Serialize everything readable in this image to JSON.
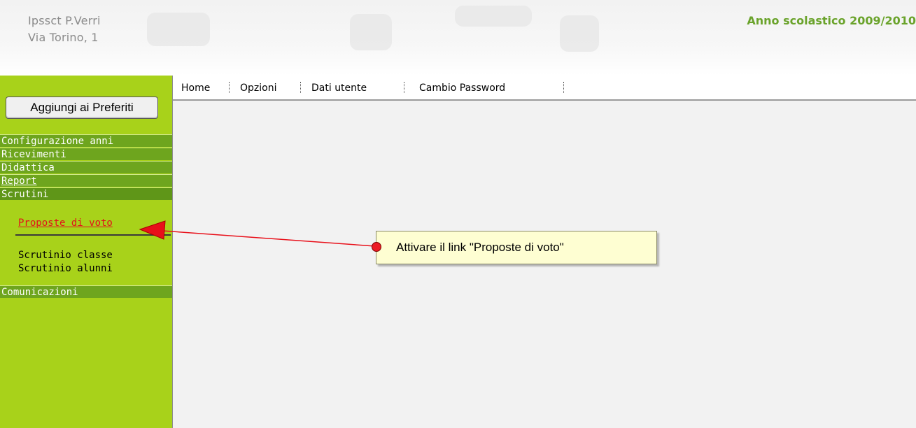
{
  "header": {
    "school_name": "Ipssct P.Verri",
    "school_address": "Via Torino, 1",
    "school_year": "Anno scolastico 2009/2010"
  },
  "sidebar": {
    "favorites_button": "Aggiungi ai Preferiti",
    "menu": [
      {
        "label": "Configurazione anni"
      },
      {
        "label": "Ricevimenti"
      },
      {
        "label": "Didattica"
      },
      {
        "label": "Report"
      },
      {
        "label": "Scrutini"
      },
      {
        "label": "Comunicazioni"
      }
    ],
    "submenu": {
      "proposte": "Proposte di voto",
      "classe": "Scrutinio classe",
      "alunni": "Scrutinio alunni"
    }
  },
  "topnav": {
    "items": [
      "Home",
      "Opzioni",
      "Dati utente",
      "Cambio Password"
    ]
  },
  "callout": {
    "text": "Attivare il link \"Proposte di voto\""
  },
  "colors": {
    "sidebar_bg": "#a8d21a",
    "menu_bar": "#6ea51e",
    "year_text": "#6aa32b",
    "active_link": "#e4101a",
    "callout_bg": "#fefed2",
    "arrow": "#e8101a"
  }
}
